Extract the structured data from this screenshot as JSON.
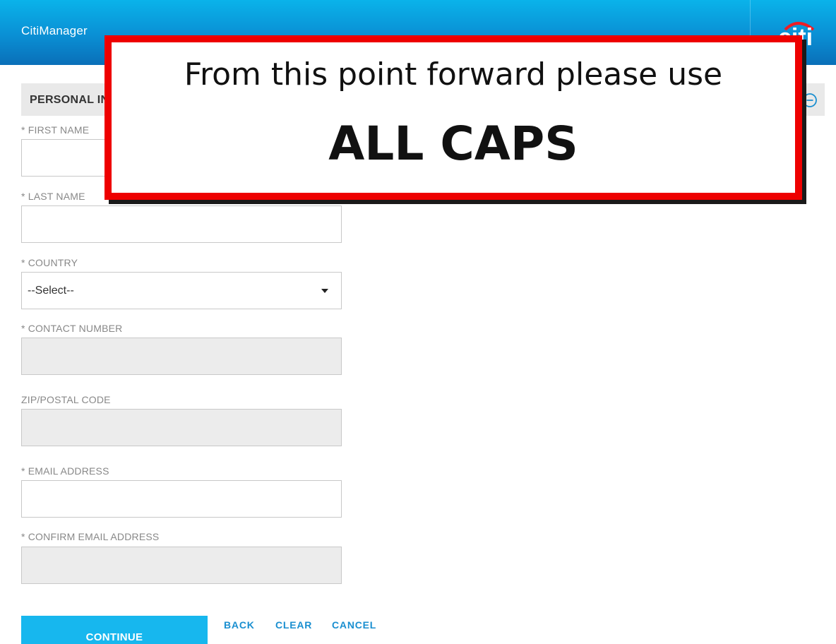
{
  "header": {
    "app_title": "CitiManager",
    "logo_text": "citi"
  },
  "section": {
    "title": "PERSONAL INFORMATION"
  },
  "form": {
    "first_name_label": "* FIRST NAME",
    "first_name_value": "",
    "last_name_label": "* LAST NAME",
    "last_name_value": "",
    "country_label": "* COUNTRY",
    "country_selected": "--Select--",
    "contact_number_label": "* CONTACT NUMBER",
    "zip_label": "ZIP/POSTAL CODE",
    "email_label": "* EMAIL ADDRESS",
    "email_value": "",
    "confirm_email_label": "* CONFIRM EMAIL ADDRESS"
  },
  "actions": {
    "continue_label": "CONTINUE",
    "back_label": "BACK",
    "clear_label": "CLEAR",
    "cancel_label": "CANCEL"
  },
  "callout": {
    "line1": "From this point forward please use",
    "line2": "ALL CAPS"
  },
  "colors": {
    "header_blue": "#0a8fd4",
    "accent_blue": "#17b7ee",
    "link_blue": "#1a8fd0",
    "callout_red": "#ee0000",
    "logo_arc_red": "#ee1c25"
  },
  "icons": {
    "collapse": "minus-circle-icon",
    "dropdown": "caret-down-icon"
  }
}
